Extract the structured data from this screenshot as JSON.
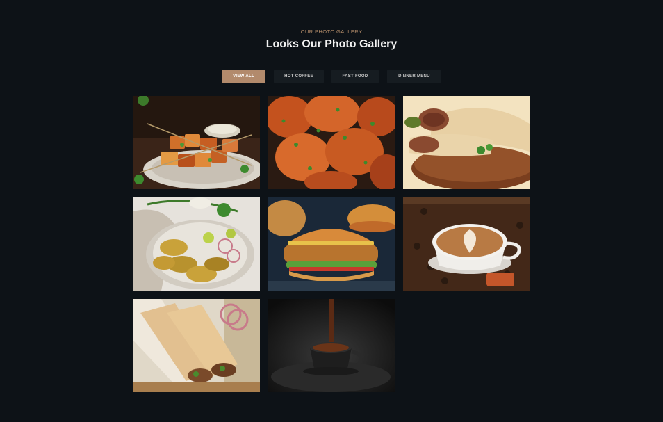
{
  "section": {
    "eyebrow": "OUR PHOTO GALLERY",
    "title": "Looks Our Photo Gallery"
  },
  "filters": [
    {
      "label": "VIEW ALL",
      "active": true
    },
    {
      "label": "HOT COFFEE",
      "active": false
    },
    {
      "label": "FAST FOOD",
      "active": false
    },
    {
      "label": "DINNER MENU",
      "active": false
    }
  ],
  "gallery": [
    {
      "subject": "paneer tikka skewers"
    },
    {
      "subject": "grilled spicy chicken"
    },
    {
      "subject": "meat wrap roll"
    },
    {
      "subject": "tandoori chicken platter"
    },
    {
      "subject": "chicken burger"
    },
    {
      "subject": "latte art coffee"
    },
    {
      "subject": "kathi roll wraps"
    },
    {
      "subject": "coffee pour"
    }
  ],
  "colors": {
    "background": "#0d1217",
    "accent": "#b28a6c",
    "button": "#161c21"
  }
}
